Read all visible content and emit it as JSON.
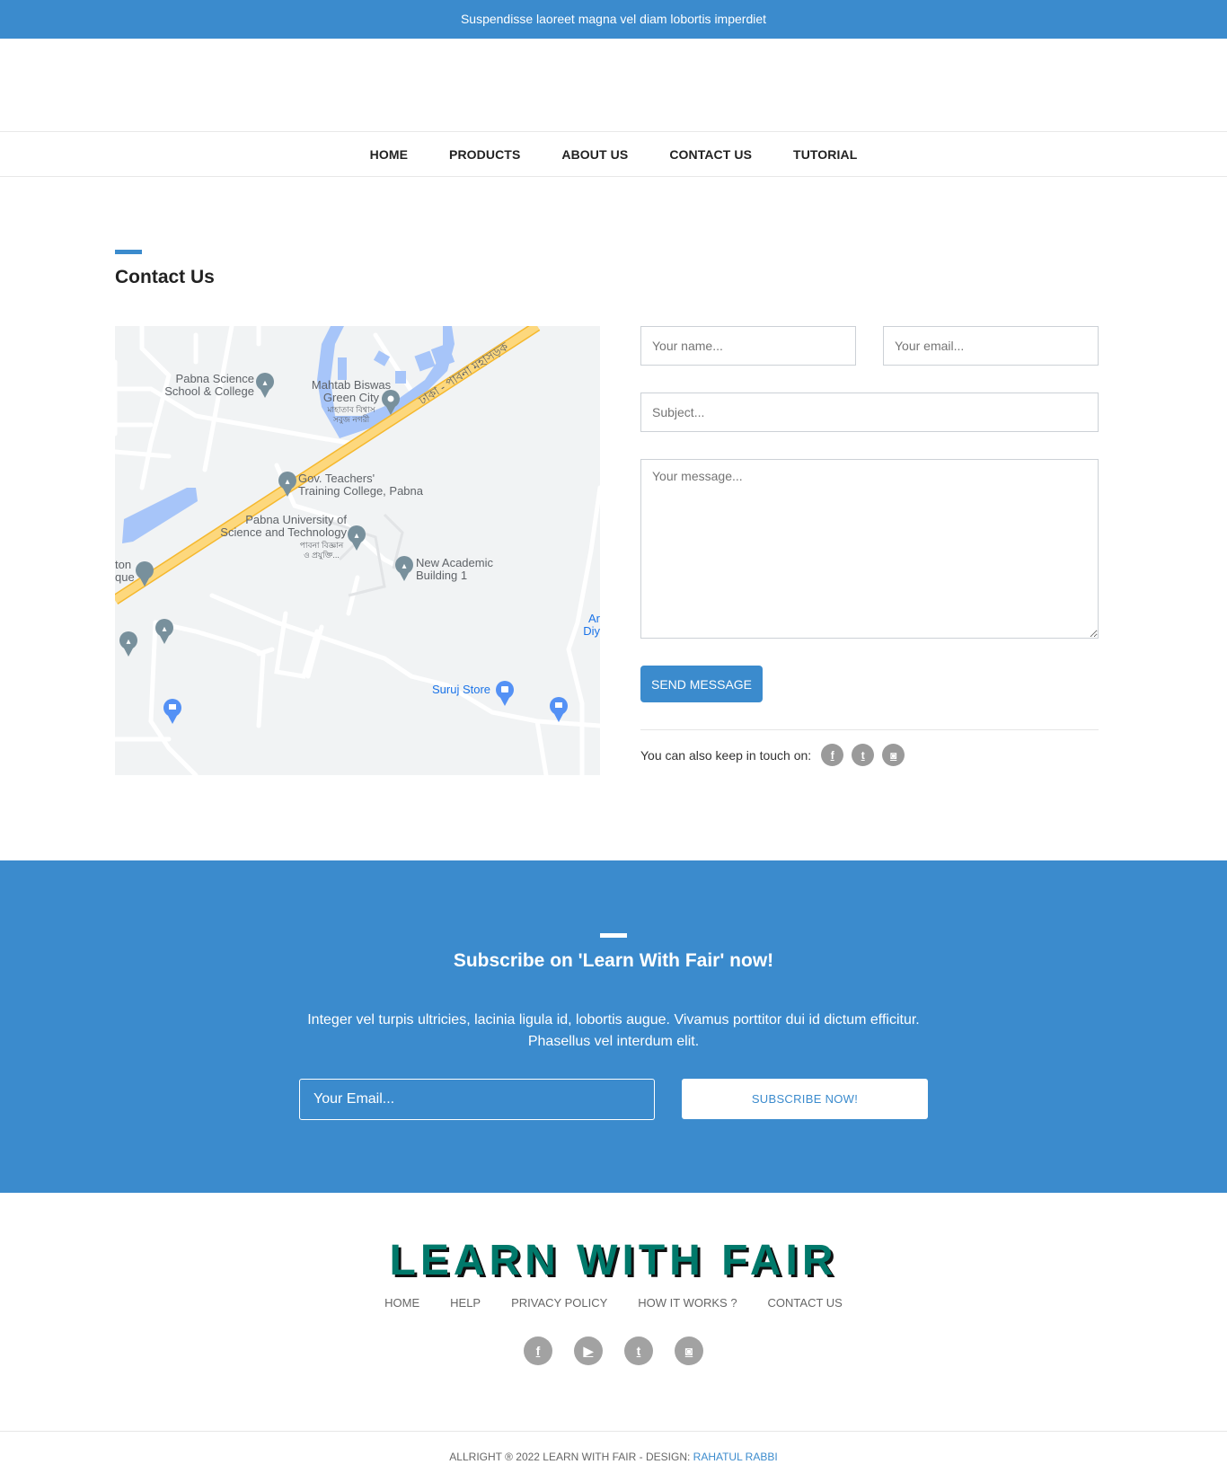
{
  "topbar": {
    "text": "Suspendisse laoreet magna vel diam lobortis imperdiet"
  },
  "nav": {
    "items": [
      {
        "label": "HOME"
      },
      {
        "label": "PRODUCTS"
      },
      {
        "label": "ABOUT US"
      },
      {
        "label": "CONTACT US"
      },
      {
        "label": "TUTORIAL"
      }
    ]
  },
  "contact": {
    "title": "Contact Us",
    "map": {
      "labels": {
        "school": [
          "Pabna Science",
          "School & College"
        ],
        "green_city": [
          "Mahtab Biswas",
          "Green City",
          "মাহাতাব বিশ্বাস",
          "সবুজ নগরী"
        ],
        "road": "ঢাকা - পাবনা মহাসড়ক",
        "teachers": [
          "Gov. Teachers'",
          "Training College, Pabna"
        ],
        "university": [
          "Pabna University of",
          "Science and Technology",
          "পাবনা বিজ্ঞান",
          "ও প্রযুক্তি..."
        ],
        "academic": [
          "New Academic",
          "Building 1"
        ],
        "mosque": [
          "ton",
          "que"
        ],
        "store": "Suruj Store",
        "edge": [
          "Ar",
          "Diy"
        ]
      }
    },
    "form": {
      "name_placeholder": "Your name...",
      "email_placeholder": "Your email...",
      "subject_placeholder": "Subject...",
      "message_placeholder": "Your message...",
      "send_label": "SEND MESSAGE",
      "touch_label": "You can also keep in touch on:",
      "social": [
        {
          "icon": "facebook-icon",
          "glyph": "f"
        },
        {
          "icon": "twitter-icon",
          "glyph": "t"
        },
        {
          "icon": "instagram-icon",
          "glyph": "◙"
        }
      ]
    }
  },
  "subscribe": {
    "title": "Subscribe on 'Learn With Fair' now!",
    "text": "Integer vel turpis ultricies, lacinia ligula id, lobortis augue. Vivamus porttitor dui id dictum efficitur. Phasellus vel interdum elit.",
    "email_placeholder": "Your Email...",
    "button_label": "SUBSCRIBE NOW!"
  },
  "footer": {
    "brand": "LEARN WITH FAIR",
    "links": [
      {
        "label": "HOME"
      },
      {
        "label": "HELP"
      },
      {
        "label": "PRIVACY POLICY"
      },
      {
        "label": "HOW IT WORKS ?"
      },
      {
        "label": "CONTACT US"
      }
    ],
    "social": [
      {
        "icon": "facebook-icon",
        "glyph": "f"
      },
      {
        "icon": "youtube-icon",
        "glyph": "▶"
      },
      {
        "icon": "twitter-icon",
        "glyph": "t"
      },
      {
        "icon": "instagram-icon",
        "glyph": "◙"
      }
    ],
    "copyright": "ALLRIGHT ® 2022 LEARN WITH FAIR - DESIGN: ",
    "designer": "RAHATUL RABBI"
  },
  "colors": {
    "accent": "#3b8bcd",
    "brand": "#00796b",
    "social_gray": "#9a9a9a"
  }
}
